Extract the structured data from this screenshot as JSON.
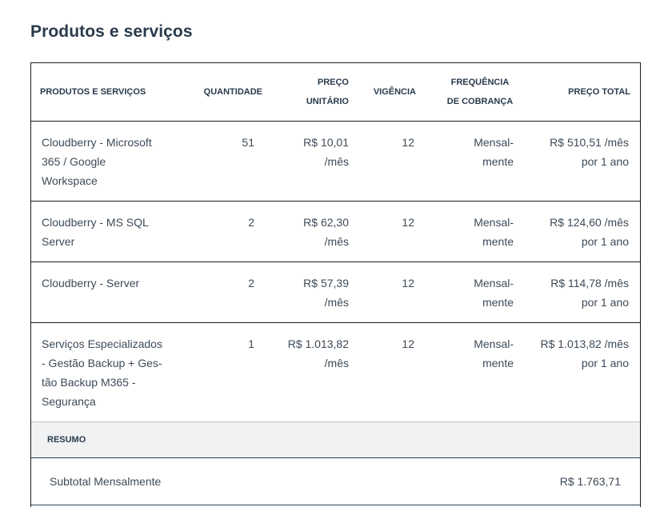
{
  "page_title": "Produtos e serviços",
  "table": {
    "headers": {
      "product": "PRODUTOS E SERVIÇOS",
      "quantity": "QUANTIDADE",
      "unit_price_line1": "PREÇO",
      "unit_price_line2": "UNITÁRIO",
      "term": "VIGÊNCIA",
      "frequency_line1": "FREQUÊNCIA",
      "frequency_line2": "DE COBRANÇA",
      "total_price": "PREÇO TOTAL"
    },
    "rows": [
      {
        "product_lines": [
          "Cloudberry - Microsoft",
          "365 / Google",
          "Workspace"
        ],
        "quantity": "51",
        "unit_price": "R$ 10,01",
        "unit_suffix": "/mês",
        "term": "12",
        "frequency_line1": "Mensal-",
        "frequency_line2": "mente",
        "total_line1": "R$ 510,51 /mês",
        "total_line2": "por 1 ano"
      },
      {
        "product_lines": [
          "Cloudberry - MS SQL",
          "Server"
        ],
        "quantity": "2",
        "unit_price": "R$ 62,30",
        "unit_suffix": "/mês",
        "term": "12",
        "frequency_line1": "Mensal-",
        "frequency_line2": "mente",
        "total_line1": "R$ 124,60 /mês",
        "total_line2": "por 1 ano"
      },
      {
        "product_lines": [
          "Cloudberry - Server"
        ],
        "quantity": "2",
        "unit_price": "R$ 57,39",
        "unit_suffix": "/mês",
        "term": "12",
        "frequency_line1": "Mensal-",
        "frequency_line2": "mente",
        "total_line1": "R$ 114,78 /mês",
        "total_line2": "por 1 ano"
      },
      {
        "product_lines": [
          "Serviços Especializados",
          "- Gestão Backup + Ges-",
          "tão Backup M365 -",
          "Segurança"
        ],
        "quantity": "1",
        "unit_price": "R$ 1.013,82",
        "unit_suffix": "/mês",
        "term": "12",
        "frequency_line1": "Mensal-",
        "frequency_line2": "mente",
        "total_line1": "R$ 1.013,82 /mês",
        "total_line2": "por 1 ano"
      }
    ]
  },
  "summary": {
    "heading": "RESUMO",
    "subtotal_label": "Subtotal Mensalmente",
    "subtotal_value": "R$ 1.763,71"
  }
}
